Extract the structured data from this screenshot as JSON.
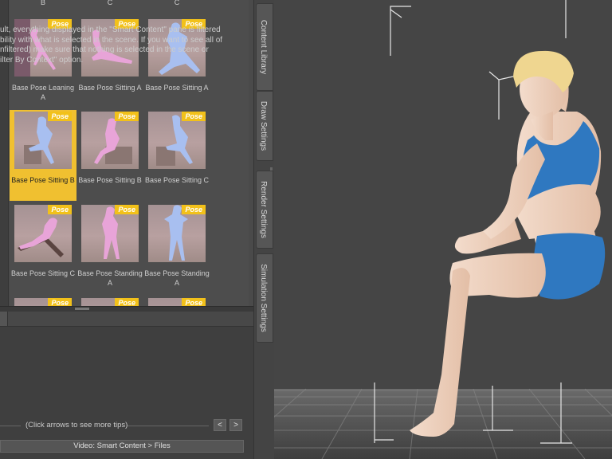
{
  "content_library": {
    "top_row_labels": [
      "B",
      "C",
      "C"
    ],
    "badge_text": "Pose",
    "items": [
      {
        "label": "Base Pose Leaning A",
        "selected": false
      },
      {
        "label": "Base Pose Sitting A",
        "selected": false
      },
      {
        "label": "Base Pose Sitting A",
        "selected": false
      },
      {
        "label": "Base Pose Sitting B",
        "selected": true
      },
      {
        "label": "Base Pose Sitting B",
        "selected": false
      },
      {
        "label": "Base Pose Sitting C",
        "selected": false
      },
      {
        "label": "Base Pose Sitting C",
        "selected": false
      },
      {
        "label": "Base Pose Standing A",
        "selected": false
      },
      {
        "label": "Base Pose Standing A",
        "selected": false
      }
    ]
  },
  "tips": {
    "lines": [
      "ult, everything displayed in the \"Smart Content\" pane is filtered",
      "bility with what is selected in the scene. If you want to see all of",
      "nfiltered) make sure that nothing is selected in the scene or",
      "ilter By Context\" option."
    ],
    "hint": "(Click arrows to see more tips)",
    "prev_label": "<",
    "next_label": ">",
    "video_button": "Video: Smart Content > Files"
  },
  "side_tabs": [
    "Content Library",
    "Draw Settings",
    "Render Settings",
    "Simulation Settings"
  ],
  "colors": {
    "selection": "#f0c030",
    "badge": "#f2c11a"
  }
}
